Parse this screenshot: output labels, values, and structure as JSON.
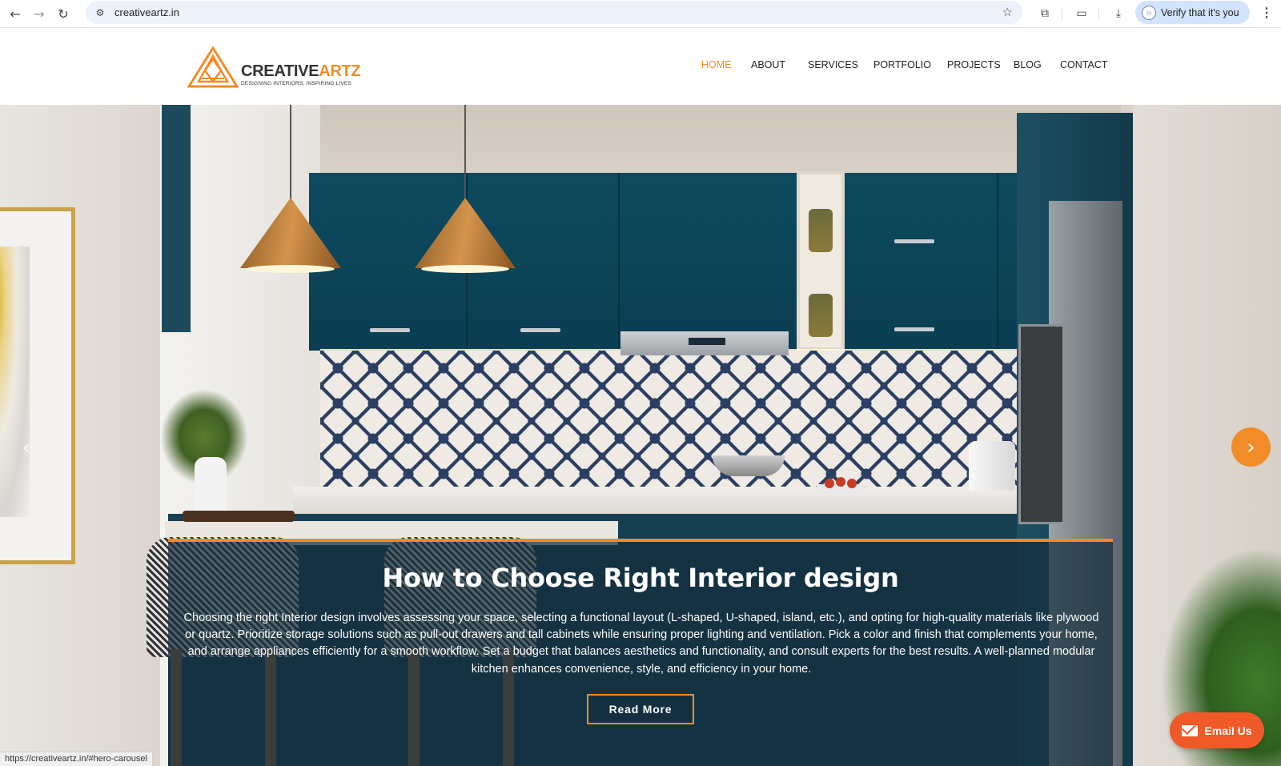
{
  "browser": {
    "url": "creativeartz.in",
    "verify_label": "Verify that it's you",
    "status_url": "https://creativeartz.in/#hero-carousel"
  },
  "logo": {
    "name_part1": "CREATIVE",
    "name_part2": "ARTZ",
    "tagline": "DESIGNING INTERIORS, INSPIRING LIVES"
  },
  "nav": {
    "items": [
      {
        "label": "HOME",
        "active": true
      },
      {
        "label": "ABOUT"
      },
      {
        "label": "SERVICES"
      },
      {
        "label": "PORTFOLIO"
      },
      {
        "label": "PROJECTS"
      },
      {
        "label": "BLOG"
      },
      {
        "label": "CONTACT"
      }
    ]
  },
  "hero": {
    "title": "How to Choose Right Interior design",
    "body": "Choosing the right Interior design involves assessing your space, selecting a functional layout (L-shaped, U-shaped, island, etc.), and opting for high-quality materials like plywood or quartz. Prioritize storage solutions such as pull-out drawers and tall cabinets while ensuring proper lighting and ventilation. Pick a color and finish that complements your home, and arrange appliances efficiently for a smooth workflow. Set a budget that balances aesthetics and functionality, and consult experts for the best results. A well-planned modular kitchen enhances convenience, style, and efficiency in your home.",
    "cta": "Read More"
  },
  "floating": {
    "email_label": "Email Us"
  },
  "colors": {
    "accent": "#f28c28",
    "email_button": "#f05a28",
    "caption_bg": "#152e3c"
  },
  "icons": {
    "back": "back-arrow-icon",
    "forward": "forward-arrow-icon",
    "reload": "reload-icon",
    "site_info": "site-info-icon",
    "bookmark": "star-icon",
    "extensions": "puzzle-icon",
    "cast": "cast-icon",
    "download": "download-icon",
    "menu": "kebab-menu-icon",
    "carousel_next": "chevron-right-icon",
    "carousel_prev": "chevron-left-icon",
    "email": "envelope-icon"
  }
}
